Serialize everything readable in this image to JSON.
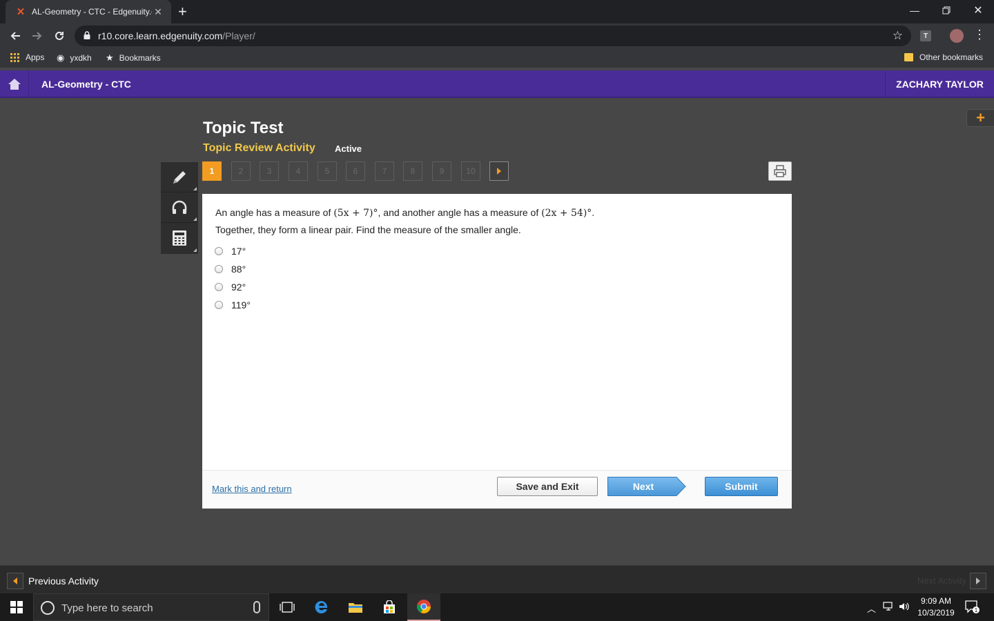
{
  "browser": {
    "tab_title": "AL-Geometry - CTC - Edgenuity.c",
    "url_host": "r10.core.learn.edgenuity.com",
    "url_path": "/Player/",
    "extension_letter": "T",
    "bookmarks": {
      "apps": "Apps",
      "item1": "yxdkh",
      "item2": "Bookmarks",
      "other": "Other bookmarks"
    }
  },
  "header": {
    "course": "AL-Geometry - CTC",
    "user": "ZACHARY TAYLOR"
  },
  "activity": {
    "title": "Topic Test",
    "subtitle": "Topic Review Activity",
    "status": "Active"
  },
  "question_nav": {
    "numbers": [
      "1",
      "2",
      "3",
      "4",
      "5",
      "6",
      "7",
      "8",
      "9",
      "10"
    ],
    "current": 1
  },
  "question": {
    "text_part1": "An angle has a measure of ",
    "expr1": "(5x + 7)°",
    "text_part2": ", and another angle has a measure of ",
    "expr2": "(2x + 54)°",
    "text_part3": ".",
    "text_line2": "Together, they form a linear pair. Find the measure of the smaller angle.",
    "choices": [
      "17°",
      "88°",
      "92°",
      "119°"
    ]
  },
  "footer": {
    "mark_link": "Mark this and return",
    "save_label": "Save and Exit",
    "next_label": "Next",
    "submit_label": "Submit"
  },
  "activity_bar": {
    "prev_label": "Previous Activity",
    "next_label": "Next Activity"
  },
  "taskbar": {
    "search_placeholder": "Type here to search",
    "time": "9:09 AM",
    "date": "10/3/2019",
    "notification_count": "1"
  },
  "colors": {
    "header_purple": "#4a2c98",
    "accent_orange": "#f39c22",
    "subtitle_yellow": "#f2c94c",
    "button_blue": "#3d8fd6"
  }
}
